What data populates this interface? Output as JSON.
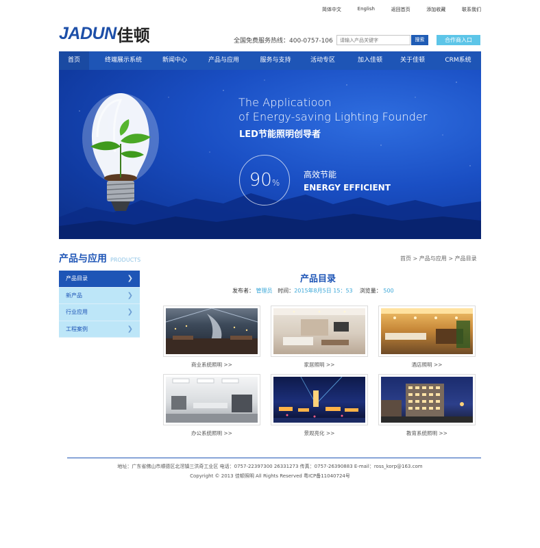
{
  "top_links": [
    "简体中文",
    "English",
    "返回首页",
    "添加收藏",
    "联系我们"
  ],
  "logo": {
    "latin": "JADUN",
    "cn": "佳顿"
  },
  "hotline": "全国免费服务热线：400-0757-106",
  "search": {
    "placeholder": "请输入产品关键字",
    "button": "搜索"
  },
  "partner_button": "合作商入口",
  "nav": [
    "首页",
    "终端展示系统",
    "新闻中心",
    "产品与应用",
    "服务与支持",
    "活动专区",
    "加入佳顿",
    "关于佳顿",
    "CRM系统"
  ],
  "banner": {
    "title_line1": "The Applicatioon",
    "title_line2": "of Energy-saving Lighting Founder",
    "subtitle": "LED节能照明创导者",
    "percent": "90",
    "percent_unit": "%",
    "efficiency_cn": "高效节能",
    "efficiency_en": "ENERGY EFFICIENT"
  },
  "section": {
    "title_cn": "产品与应用",
    "title_en": "PRODUCTS"
  },
  "breadcrumb": "首页 > 产品与应用 > 产品目录",
  "sidebar": [
    {
      "label": "产品目录",
      "active": true
    },
    {
      "label": "新产品",
      "active": false
    },
    {
      "label": "行业应用",
      "active": false
    },
    {
      "label": "工程案例",
      "active": false
    }
  ],
  "content": {
    "title": "产品目录",
    "publisher_label": "发布者：",
    "publisher": "管理员",
    "time_label": "时间：",
    "time": "2015年8月5日 15：53",
    "views_label": "浏览量：",
    "views": "500"
  },
  "products": [
    {
      "caption": "商业系统照明 >>",
      "theme": "commercial"
    },
    {
      "caption": "家居照明 >>",
      "theme": "home"
    },
    {
      "caption": "酒店照明 >>",
      "theme": "hotel"
    },
    {
      "caption": "办公系统照明 >>",
      "theme": "office"
    },
    {
      "caption": "景观亮化 >>",
      "theme": "landscape"
    },
    {
      "caption": "教育系统照明 >>",
      "theme": "education"
    }
  ],
  "footer": {
    "line1": "地址：广东省佛山市顺德区北滘镇三洪奇工业区    电话：0757-22397300 26331273    传真：0757-26390883    E-mail：ross_korp@163.com",
    "line2": "Copyright © 2013 佳顿照明 All Rights Reserved     粤ICP备11040724号"
  },
  "colors": {
    "primary": "#1e55b6",
    "accent": "#5dc5e8",
    "sidebar_bg": "#bde6f8"
  }
}
